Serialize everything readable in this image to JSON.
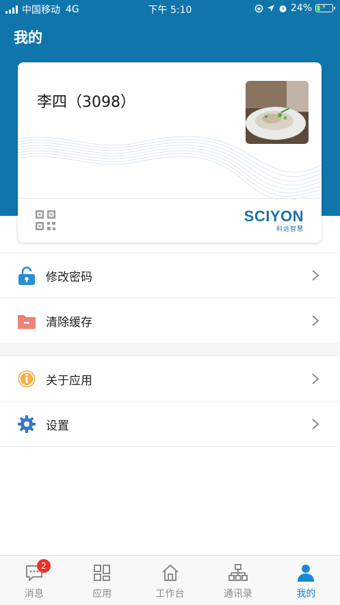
{
  "status_bar": {
    "carrier": "中国移动",
    "network": "4G",
    "time": "下午 5:10",
    "battery": "24%",
    "battery_level": 0.24
  },
  "header": {
    "title": "我的"
  },
  "profile": {
    "name": "李四（3098）",
    "brand": {
      "main": "SCIYON",
      "sub": "科远智慧"
    }
  },
  "menu": {
    "change_password": "修改密码",
    "clear_cache": "清除缓存",
    "about": "关于应用",
    "settings": "设置"
  },
  "tabs": {
    "messages": {
      "label": "消息",
      "badge": "2"
    },
    "apps": {
      "label": "应用"
    },
    "workbench": {
      "label": "工作台"
    },
    "contacts": {
      "label": "通讯录"
    },
    "mine": {
      "label": "我的"
    }
  },
  "colors": {
    "header_blue": "#0f75ab",
    "active_tab": "#1989d6",
    "badge_red": "#e8332b"
  }
}
